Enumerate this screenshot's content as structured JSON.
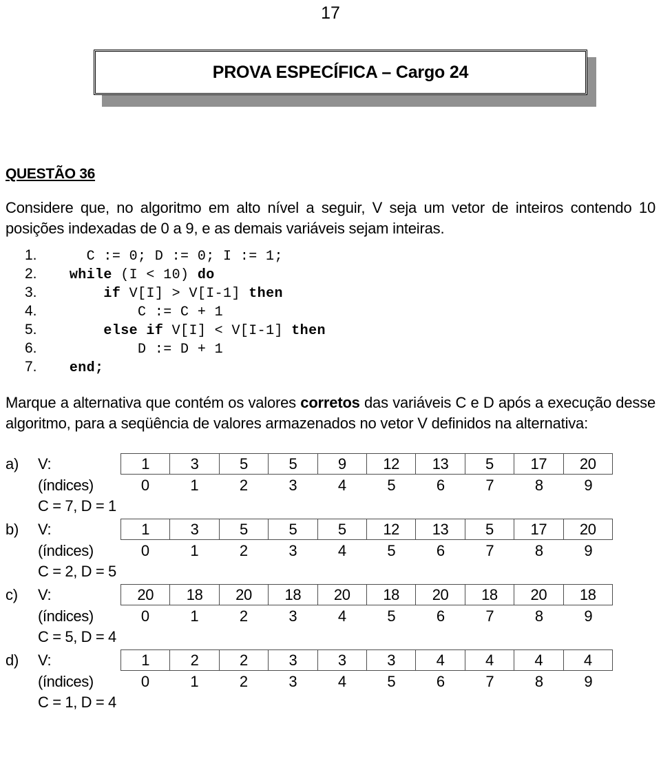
{
  "page": {
    "number": "17"
  },
  "banner": {
    "title": "PROVA ESPECÍFICA – Cargo 24"
  },
  "question": {
    "heading": "QUESTÃO 36",
    "statement_line1": "Considere que, no algoritmo em alto nível a seguir, V seja um vetor de inteiros",
    "statement_line2": "contendo 10 posições indexadas de 0 a 9, e as demais variáveis sejam inteiras.",
    "prompt_before_bold": "Marque a alternativa que contém os valores ",
    "prompt_bold": "corretos",
    "prompt_after_bold": " das variáveis C e D após a execução desse algoritmo, para a seqüência de valores armazenados no vetor V definidos na alternativa:"
  },
  "code": {
    "lines": [
      {
        "num": "1.",
        "indent": "    ",
        "segments": [
          {
            "text": "C := 0; D := 0; I := 1;",
            "bold": false
          }
        ]
      },
      {
        "num": "2.",
        "indent": "  ",
        "segments": [
          {
            "text": "while",
            "bold": true
          },
          {
            "text": " (I < 10) ",
            "bold": false
          },
          {
            "text": "do",
            "bold": true
          }
        ]
      },
      {
        "num": "3.",
        "indent": "      ",
        "segments": [
          {
            "text": "if",
            "bold": true
          },
          {
            "text": " V[I] > V[I-1] ",
            "bold": false
          },
          {
            "text": "then",
            "bold": true
          }
        ]
      },
      {
        "num": "4.",
        "indent": "          ",
        "segments": [
          {
            "text": "C := C + 1",
            "bold": false
          }
        ]
      },
      {
        "num": "5.",
        "indent": "      ",
        "segments": [
          {
            "text": "else if",
            "bold": true
          },
          {
            "text": " V[I] < V[I-1] ",
            "bold": false
          },
          {
            "text": "then",
            "bold": true
          }
        ]
      },
      {
        "num": "6.",
        "indent": "          ",
        "segments": [
          {
            "text": "D := D + 1",
            "bold": false
          }
        ]
      },
      {
        "num": "7.",
        "indent": "  ",
        "segments": [
          {
            "text": "end;",
            "bold": true
          }
        ]
      }
    ]
  },
  "alternatives": {
    "vector_label": "V:",
    "index_label": "(índices)",
    "items": [
      {
        "letter": "a)",
        "values": [
          "1",
          "3",
          "5",
          "5",
          "9",
          "12",
          "13",
          "5",
          "17",
          "20"
        ],
        "indices": [
          "0",
          "1",
          "2",
          "3",
          "4",
          "5",
          "6",
          "7",
          "8",
          "9"
        ],
        "answer": "C = 7, D = 1"
      },
      {
        "letter": "b)",
        "values": [
          "1",
          "3",
          "5",
          "5",
          "5",
          "12",
          "13",
          "5",
          "17",
          "20"
        ],
        "indices": [
          "0",
          "1",
          "2",
          "3",
          "4",
          "5",
          "6",
          "7",
          "8",
          "9"
        ],
        "answer": "C = 2, D = 5"
      },
      {
        "letter": "c)",
        "values": [
          "20",
          "18",
          "20",
          "18",
          "20",
          "18",
          "20",
          "18",
          "20",
          "18"
        ],
        "indices": [
          "0",
          "1",
          "2",
          "3",
          "4",
          "5",
          "6",
          "7",
          "8",
          "9"
        ],
        "answer": "C = 5, D = 4"
      },
      {
        "letter": "d)",
        "values": [
          "1",
          "2",
          "2",
          "3",
          "3",
          "3",
          "4",
          "4",
          "4",
          "4"
        ],
        "indices": [
          "0",
          "1",
          "2",
          "3",
          "4",
          "5",
          "6",
          "7",
          "8",
          "9"
        ],
        "answer": "C = 1, D = 4"
      }
    ]
  }
}
